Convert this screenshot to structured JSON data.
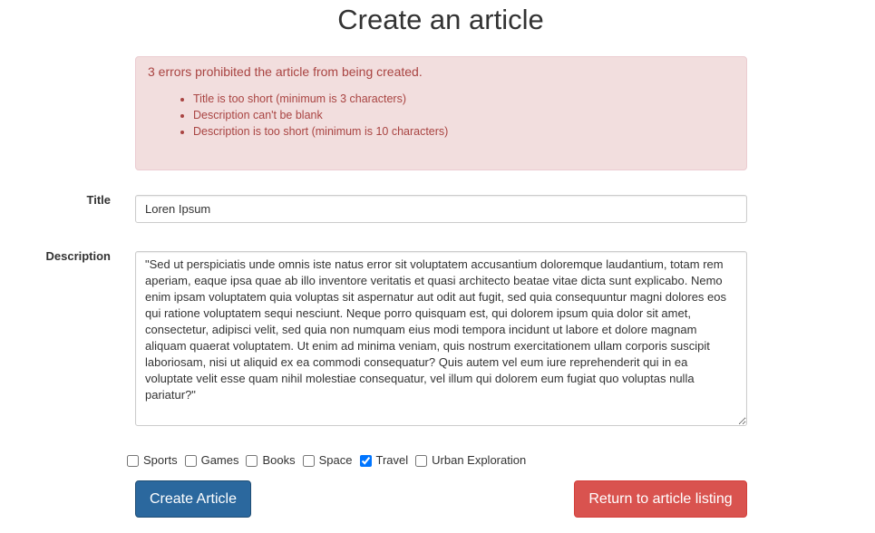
{
  "page": {
    "title": "Create an article"
  },
  "errors": {
    "heading": "3 errors prohibited the article from being created.",
    "items": [
      "Title is too short (minimum is 3 characters)",
      "Description can't be blank",
      "Description is too short (minimum is 10 characters)"
    ]
  },
  "form": {
    "title": {
      "label": "Title",
      "value": "Loren Ipsum"
    },
    "description": {
      "label": "Description",
      "value": "\"Sed ut perspiciatis unde omnis iste natus error sit voluptatem accusantium doloremque laudantium, totam rem aperiam, eaque ipsa quae ab illo inventore veritatis et quasi architecto beatae vitae dicta sunt explicabo. Nemo enim ipsam voluptatem quia voluptas sit aspernatur aut odit aut fugit, sed quia consequuntur magni dolores eos qui ratione voluptatem sequi nesciunt. Neque porro quisquam est, qui dolorem ipsum quia dolor sit amet, consectetur, adipisci velit, sed quia non numquam eius modi tempora incidunt ut labore et dolore magnam aliquam quaerat voluptatem. Ut enim ad minima veniam, quis nostrum exercitationem ullam corporis suscipit laboriosam, nisi ut aliquid ex ea commodi consequatur? Quis autem vel eum iure reprehenderit qui in ea voluptate velit esse quam nihil molestiae consequatur, vel illum qui dolorem eum fugiat quo voluptas nulla pariatur?\""
    },
    "categories": [
      {
        "label": "Sports",
        "checked": false
      },
      {
        "label": "Games",
        "checked": false
      },
      {
        "label": "Books",
        "checked": false
      },
      {
        "label": "Space",
        "checked": false
      },
      {
        "label": "Travel",
        "checked": true
      },
      {
        "label": "Urban Exploration",
        "checked": false
      }
    ],
    "submit_label": "Create Article",
    "back_label": "Return to article listing"
  },
  "colors": {
    "error_text": "#a94442",
    "error_background": "#f2dede",
    "primary": "#2b689e",
    "danger": "#d9534f"
  }
}
